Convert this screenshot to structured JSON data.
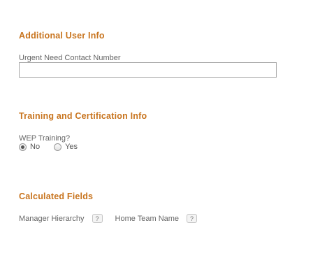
{
  "additional_user_info": {
    "title": "Additional User Info",
    "urgent_contact_label": "Urgent Need Contact Number",
    "urgent_contact_value": ""
  },
  "training_certification_info": {
    "title": "Training and Certification Info",
    "wep_training_label": "WEP Training?",
    "options": [
      {
        "label": "No",
        "selected": true
      },
      {
        "label": "Yes",
        "selected": false
      }
    ]
  },
  "calculated_fields": {
    "title": "Calculated Fields",
    "fields": [
      {
        "label": "Manager Hierarchy",
        "help_icon": "?"
      },
      {
        "label": "Home Team Name",
        "help_icon": "?"
      }
    ]
  },
  "colors": {
    "section_title": "#c8741e",
    "label_text": "#666666",
    "input_border": "#a9a9a9"
  }
}
